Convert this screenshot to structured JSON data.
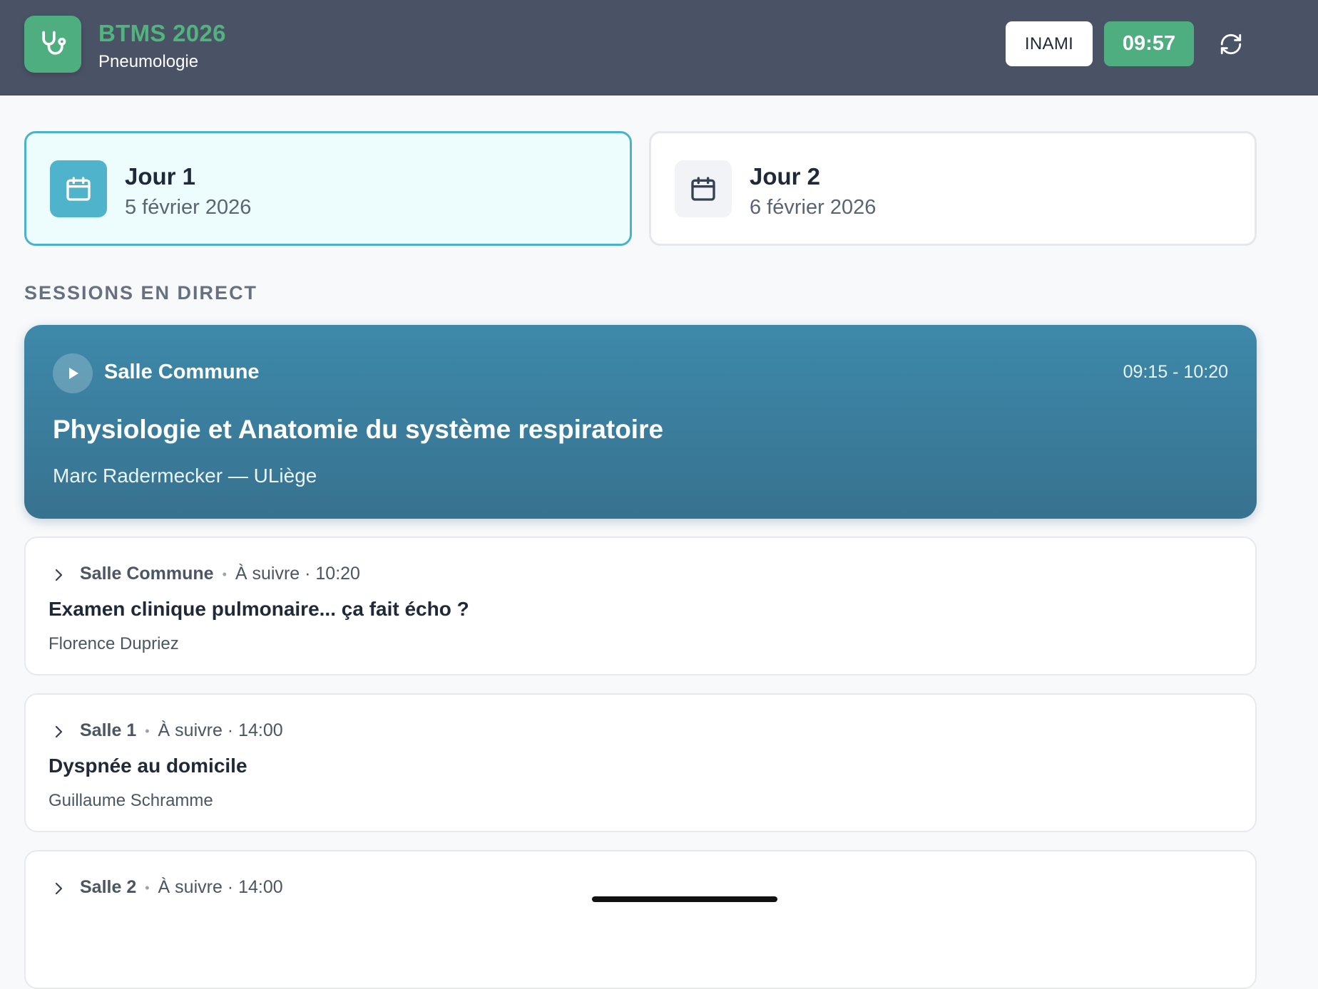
{
  "header": {
    "app_name": "BTMS 2026",
    "specialty": "Pneumologie",
    "inami_label": "INAMI",
    "clock": "09:57",
    "logo_icon": "stethoscope-icon",
    "refresh_icon": "refresh-icon"
  },
  "days": [
    {
      "label": "Jour 1",
      "date": "5 février 2026",
      "selected": true,
      "icon": "calendar-icon"
    },
    {
      "label": "Jour 2",
      "date": "6 février 2026",
      "selected": false,
      "icon": "calendar-icon"
    }
  ],
  "section_title": "SESSIONS EN DIRECT",
  "live_session": {
    "room": "Salle Commune",
    "time_range": "09:15 - 10:20",
    "title": "Physiologie et Anatomie du système respiratoire",
    "speaker": "Marc Radermecker — ULiège",
    "icon": "play-icon"
  },
  "upcoming_sessions": [
    {
      "room": "Salle Commune",
      "status": "À suivre · 10:20",
      "title": "Examen clinique pulmonaire... ça fait écho ?",
      "speaker": "Florence Dupriez"
    },
    {
      "room": "Salle 1",
      "status": "À suivre · 14:00",
      "title": "Dyspnée au domicile",
      "speaker": "Guillaume Schramme"
    },
    {
      "room": "Salle 2",
      "status": "À suivre · 14:00",
      "title": "",
      "speaker": ""
    }
  ],
  "colors": {
    "header_bg": "#4a5366",
    "accent_green": "#4fae7f",
    "accent_teal": "#4bb2cc",
    "live_card": "#3e89aa"
  }
}
